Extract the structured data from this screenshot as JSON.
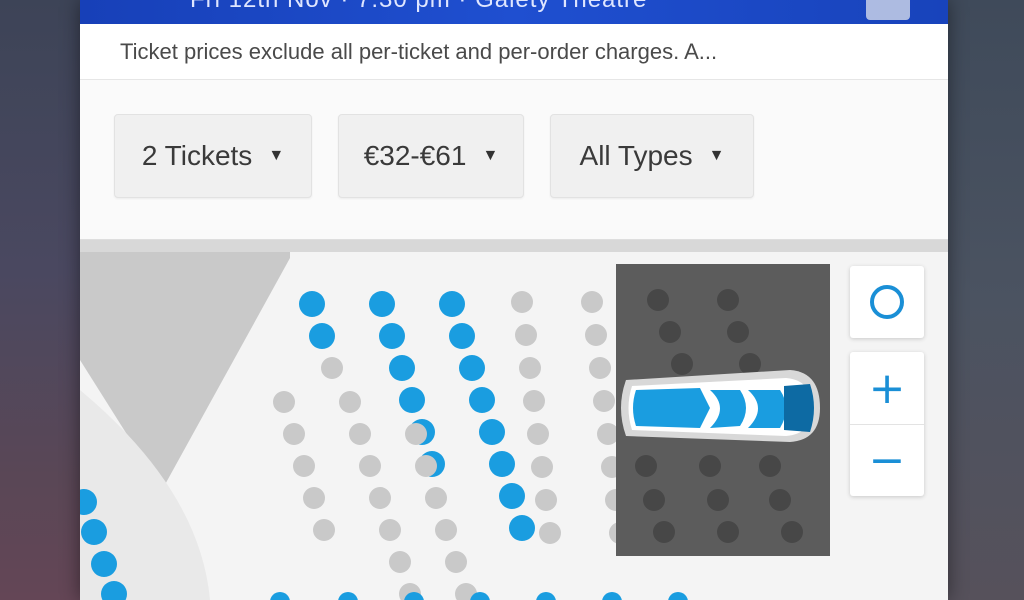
{
  "header": {
    "title_partial": "Fri 12th Nov · 7:30 pm · Gaiety Theatre"
  },
  "notice": {
    "text": "Ticket prices exclude all per-ticket and per-order charges. A..."
  },
  "filters": {
    "quantity": {
      "selected": "2 Tickets"
    },
    "price": {
      "selected": "€32-€61"
    },
    "type": {
      "selected": "All Types"
    }
  },
  "map_controls": {
    "reset_icon": "ring-icon",
    "zoom_in_label": "+",
    "zoom_out_label": "−"
  },
  "colors": {
    "header_blue": "#1f4fd0",
    "available_seat": "#1a9de0",
    "unavailable_seat": "#c9c9c9",
    "preview_overlay": "#5c5c5c",
    "accent": "#1a8fd6"
  },
  "legend_status": [
    "available",
    "unavailable"
  ]
}
